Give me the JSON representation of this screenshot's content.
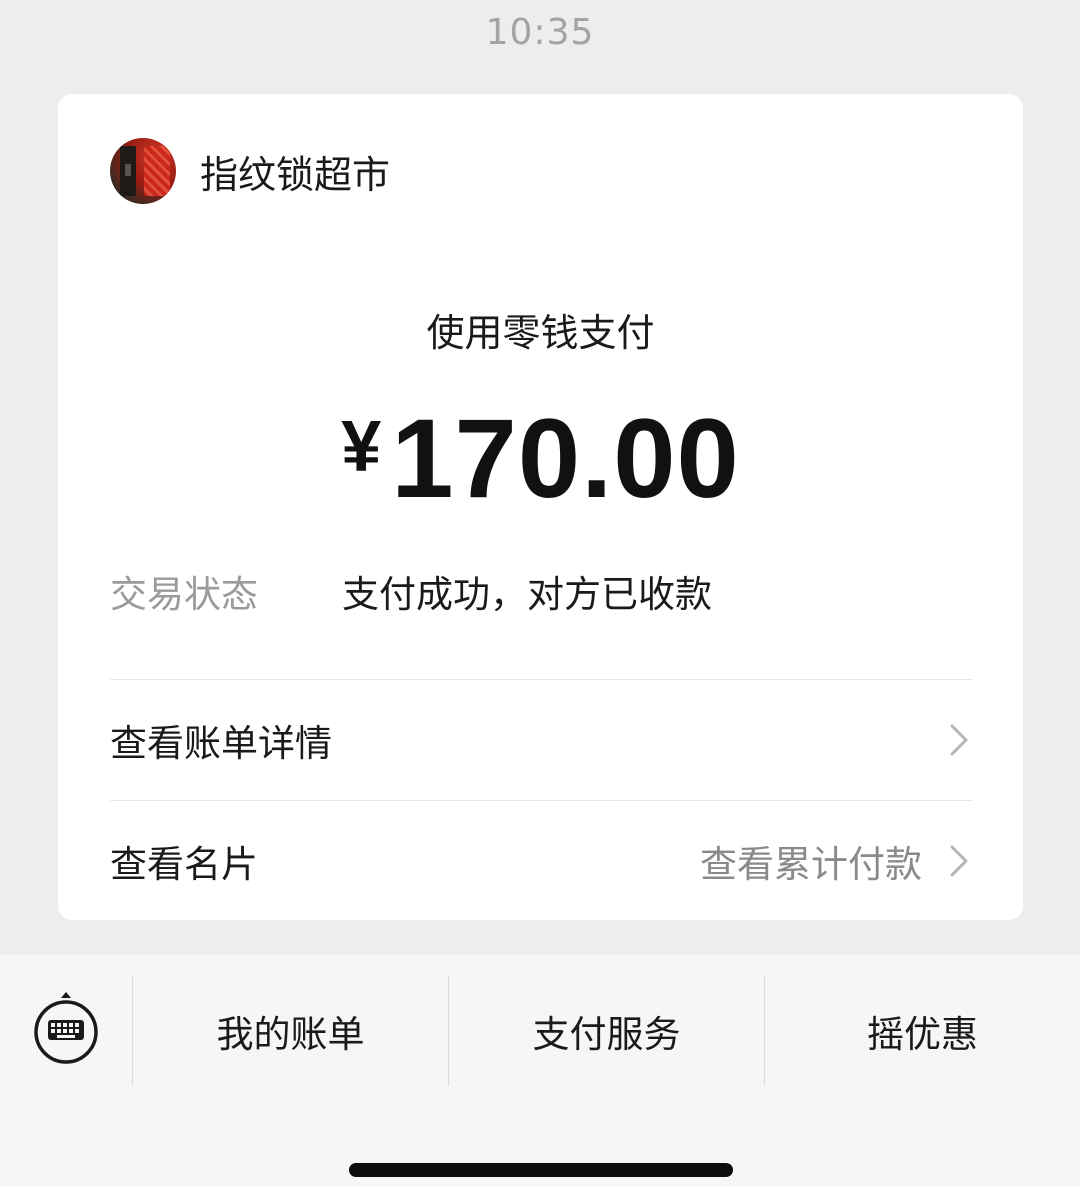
{
  "status_bar": {
    "time": "10:35"
  },
  "merchant": {
    "name": "指纹锁超市",
    "avatar_icon": "merchant-avatar"
  },
  "payment": {
    "method": "使用零钱支付",
    "currency_symbol": "¥",
    "amount": "170.00"
  },
  "status": {
    "label": "交易状态",
    "value": "支付成功，对方已收款"
  },
  "rows": [
    {
      "label": "查看账单详情",
      "extra": "",
      "icon": "chevron-right-icon"
    },
    {
      "label": "查看名片",
      "extra": "查看累计付款",
      "icon": "chevron-right-icon"
    }
  ],
  "bottom_menu": {
    "keyboard_icon": "keyboard-icon",
    "items": [
      "我的账单",
      "支付服务",
      "摇优惠"
    ]
  },
  "colors": {
    "background": "#ededed",
    "card": "#ffffff",
    "secondary_text": "#9b9b9b",
    "bottom_bar": "#f6f6f6"
  }
}
